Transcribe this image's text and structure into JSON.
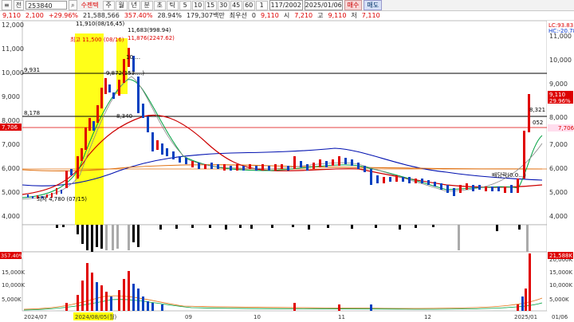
{
  "toolbar": {
    "menu_glyph": "≡",
    "market_label": "전",
    "code": "253840",
    "search_glyph": "⌕",
    "name_label": "수젠텍",
    "periods": [
      "주",
      "월",
      "년",
      "분",
      "초",
      "틱",
      "5",
      "10",
      "15",
      "30",
      "45",
      "60",
      "1"
    ],
    "page_counter": "117/2002",
    "date": "2025/01/06",
    "buy_label": "매수",
    "sell_label": "매도"
  },
  "quote": {
    "price": "9,110",
    "change": "2,100",
    "change_rate": "+29.96%",
    "volume": "21,588,566",
    "volume_ratio": "357.40%",
    "turnover": "28.94%",
    "amount": "179,307백만",
    "preferred_label": "최우선",
    "preferred_qty": "0",
    "current": "9,110",
    "open_label": "시",
    "open": "7,210",
    "high_label": "고",
    "high": "9,110",
    "low_label": "저",
    "low": "7,110"
  },
  "price_panel": {
    "y_ticks": [
      "12,000",
      "11,000",
      "10,000",
      "9,000",
      "8,000",
      "7,000",
      "6,000",
      "5,000",
      "4,000"
    ],
    "lc_label": "LC:93.83",
    "hc_label": "HC:-20.78",
    "right_price": "9,110",
    "right_rate": "29.96%",
    "right_prev": "7,706",
    "left_9931": "9,931",
    "left_8178": "8,178",
    "left_7706": "7,706",
    "ann_high_top": "11,910(08/16,45)",
    "ann_max": "최고 11,500 (08/16)",
    "ann_11683": "11,683(998.94)",
    "ann_11876": "11,876(2247.62)",
    "ann_10": "10,…",
    "ann_9872": "9,872(153.…)",
    "ann_8340": "8,340",
    "ann_low": "최저 4,780 (07/15)",
    "ann_rise": "배당락(0.0…)",
    "ann_8321": "8,321",
    "ann_052": "052"
  },
  "volume_panel": {
    "right_vol": "21,588K",
    "right_pct": "357.40%",
    "y_ticks": [
      "20,000K",
      "15,000K",
      "10,000K",
      "5,000K"
    ]
  },
  "x_axis": {
    "labels": [
      "2024/07",
      "2024/08/05(월)",
      "09",
      "10",
      "11",
      "12",
      "2025/01",
      "01/06"
    ]
  },
  "colors": {
    "up": "#e00000",
    "down": "#0040c0",
    "highlight": "#ffff00",
    "ma_red": "#cc0000",
    "ma_blue": "#0010b0",
    "ma_orange": "#e07010",
    "ma_green": "#00a040"
  }
}
